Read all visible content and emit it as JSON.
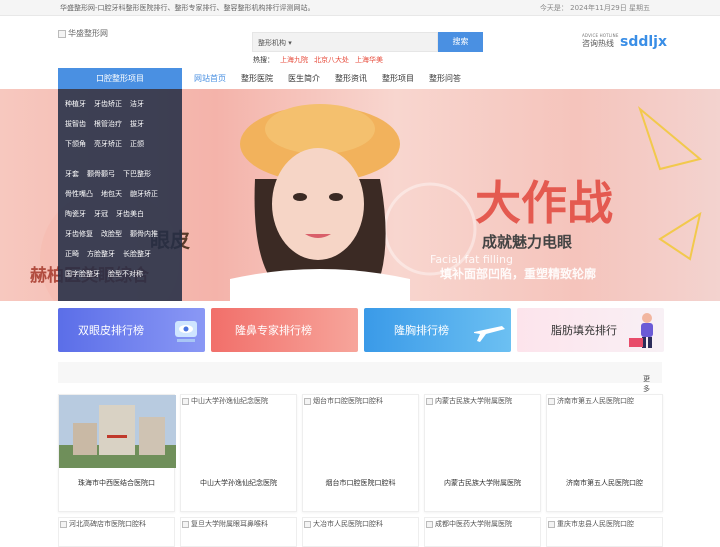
{
  "topbar": {
    "left": "华盛整形网-口腔牙科整形医院排行、整形专家排行、整容整形机构排行评测网站。",
    "right": "今天是： 2024年11月29日 星期五"
  },
  "logo": {
    "alt": "华盛整形网"
  },
  "search": {
    "category": "整形机构",
    "button": "搜索",
    "hot_label": "热搜：",
    "hot_items": [
      "上海九院",
      "北京八大处",
      "上海华美"
    ]
  },
  "hotline": {
    "small": "ADVICE HOTLINE",
    "label": "咨询热线",
    "number": "sddljx"
  },
  "nav": {
    "category": "口腔整形项目",
    "items": [
      "网站首页",
      "整形医院",
      "医生简介",
      "整形资讯",
      "整形项目",
      "整形问答"
    ]
  },
  "dropdown": {
    "rows": [
      [
        "种植牙",
        "牙齿矫正",
        "洁牙"
      ],
      [
        "拔智齿",
        "根管治疗",
        "拔牙"
      ],
      [
        "下颌角",
        "亮牙矫正",
        "正颌"
      ],
      [
        "牙套",
        "颧骨颧弓",
        "下巴整形"
      ],
      [
        "骨性嘴凸",
        "地包天",
        "龅牙矫正"
      ],
      [
        "陶瓷牙",
        "牙冠",
        "牙齿美白"
      ],
      [
        "牙齿修复",
        "改脸型",
        "颧骨内推"
      ],
      [
        "正畸",
        "方脸整牙",
        "长脸整牙"
      ],
      [
        "国字脸整牙",
        "脸型不对称"
      ]
    ]
  },
  "banner": {
    "big_text": "大作战",
    "sub_text": "成就魅力电眼",
    "left_text1": "眼皮",
    "left_text2": "赫柏医美眼综合",
    "en_text": "Facial fat filling",
    "slogan": "填补面部凹陷，重塑精致轮廓"
  },
  "cards": [
    {
      "label": "双眼皮排行榜",
      "icon": "eye-icon",
      "color": "#6b7cf0"
    },
    {
      "label": "隆鼻专家排行榜",
      "icon": "nose-icon",
      "color": "#f2837b"
    },
    {
      "label": "隆胸排行榜",
      "icon": "airplane-icon",
      "color": "#4ea8e8"
    },
    {
      "label": "脂肪填充排行",
      "icon": "person-icon",
      "color": "#fbe8ee"
    }
  ],
  "more": {
    "label": "更多机构"
  },
  "hospitals": [
    {
      "alt": "",
      "name": "珠海市中西医结合医院口"
    },
    {
      "alt": "中山大学孙逸仙纪念医院",
      "name": "中山大学孙逸仙纪念医院"
    },
    {
      "alt": "烟台市口腔医院口腔科",
      "name": "烟台市口腔医院口腔科"
    },
    {
      "alt": "内蒙古民族大学附属医院",
      "name": "内蒙古民族大学附属医院"
    },
    {
      "alt": "济南市第五人民医院口腔",
      "name": "济南市第五人民医院口腔"
    }
  ],
  "hospitals_row2": [
    {
      "alt": "河北高碑店市医院口腔科"
    },
    {
      "alt": "复旦大学附属眼耳鼻喉科"
    },
    {
      "alt": "大冶市人民医院口腔科"
    },
    {
      "alt": "成都中医药大学附属医院"
    },
    {
      "alt": "重庆市忠县人民医院口腔"
    }
  ]
}
